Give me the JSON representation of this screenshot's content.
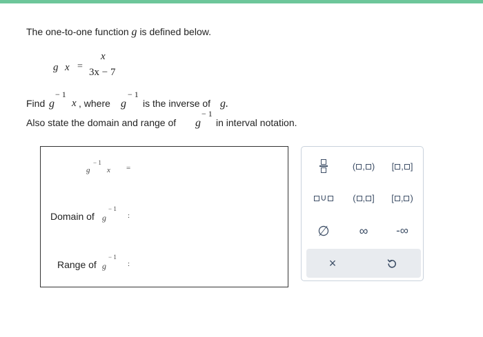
{
  "colors": {
    "top_bar": "#6dc69a",
    "keypad_text": "#3d4e66",
    "keypad_bar": "#e8ebef"
  },
  "problem": {
    "intro": "The one-to-one function g is defined below.",
    "intro_pre": "The one-to-one function",
    "intro_g": "g",
    "intro_post": "is defined below.",
    "def_lhs_g": "g",
    "def_lhs_x": "x",
    "def_equals": "=",
    "def_numerator": "x",
    "def_denominator": "3x − 7",
    "find_word": "Find",
    "find_g": "g",
    "inverse_sup": "− 1",
    "find_x": "x",
    "where_text": ", where",
    "where_g": "g",
    "is_inverse_text": "is the inverse of",
    "inverse_of_g": "g.",
    "also_state_text": "Also state the domain and range of",
    "also_state_g": "g",
    "interval_text": "in interval notation."
  },
  "answer": {
    "inv_g": "g",
    "inv_sup": "− 1",
    "inv_x": "x",
    "equals": "=",
    "domain_label": "Domain of",
    "domain_g": "g",
    "domain_sup": "− 1",
    "colon": ":",
    "range_label": "Range of",
    "range_g": "g",
    "range_sup": "− 1"
  },
  "keypad": {
    "open_open_sep": ",",
    "empty_set": "∅",
    "infinity": "∞",
    "neg_infinity": "-∞",
    "clear": "×",
    "undo_icon": "undo-icon"
  }
}
